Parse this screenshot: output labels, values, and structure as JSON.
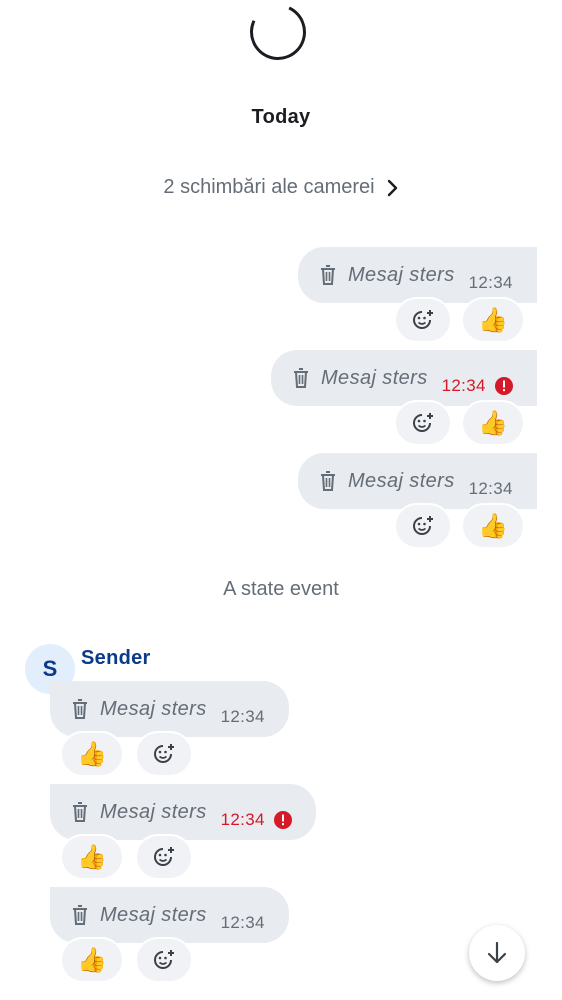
{
  "timeline": {
    "day_separator": "Today",
    "room_changes": "2 schimbări ale camerei",
    "state_event": "A state event"
  },
  "sender": {
    "name": "Sender",
    "avatar_letter": "S"
  },
  "messages": [
    {
      "text": "Mesaj sters",
      "time": "12:34",
      "failed": false,
      "reaction": "👍"
    },
    {
      "text": "Mesaj sters",
      "time": "12:34",
      "failed": true,
      "reaction": "👍"
    },
    {
      "text": "Mesaj sters",
      "time": "12:34",
      "failed": false,
      "reaction": "👍"
    },
    {
      "text": "Mesaj sters",
      "time": "12:34",
      "failed": false,
      "reaction": "👍"
    },
    {
      "text": "Mesaj sters",
      "time": "12:34",
      "failed": true,
      "reaction": "👍"
    },
    {
      "text": "Mesaj sters",
      "time": "12:34",
      "failed": false,
      "reaction": "👍"
    }
  ],
  "icons": {
    "spinner": "loading-spinner",
    "chevron": "chevron-right-icon",
    "trash": "trash-icon",
    "error": "error-icon",
    "add_reaction": "add-reaction-icon",
    "scroll_down": "arrow-down-icon"
  },
  "colors": {
    "error": "#d51928",
    "sender": "#0a3a8c",
    "bubble": "#e8ebf0",
    "secondary_text": "#656d77"
  }
}
